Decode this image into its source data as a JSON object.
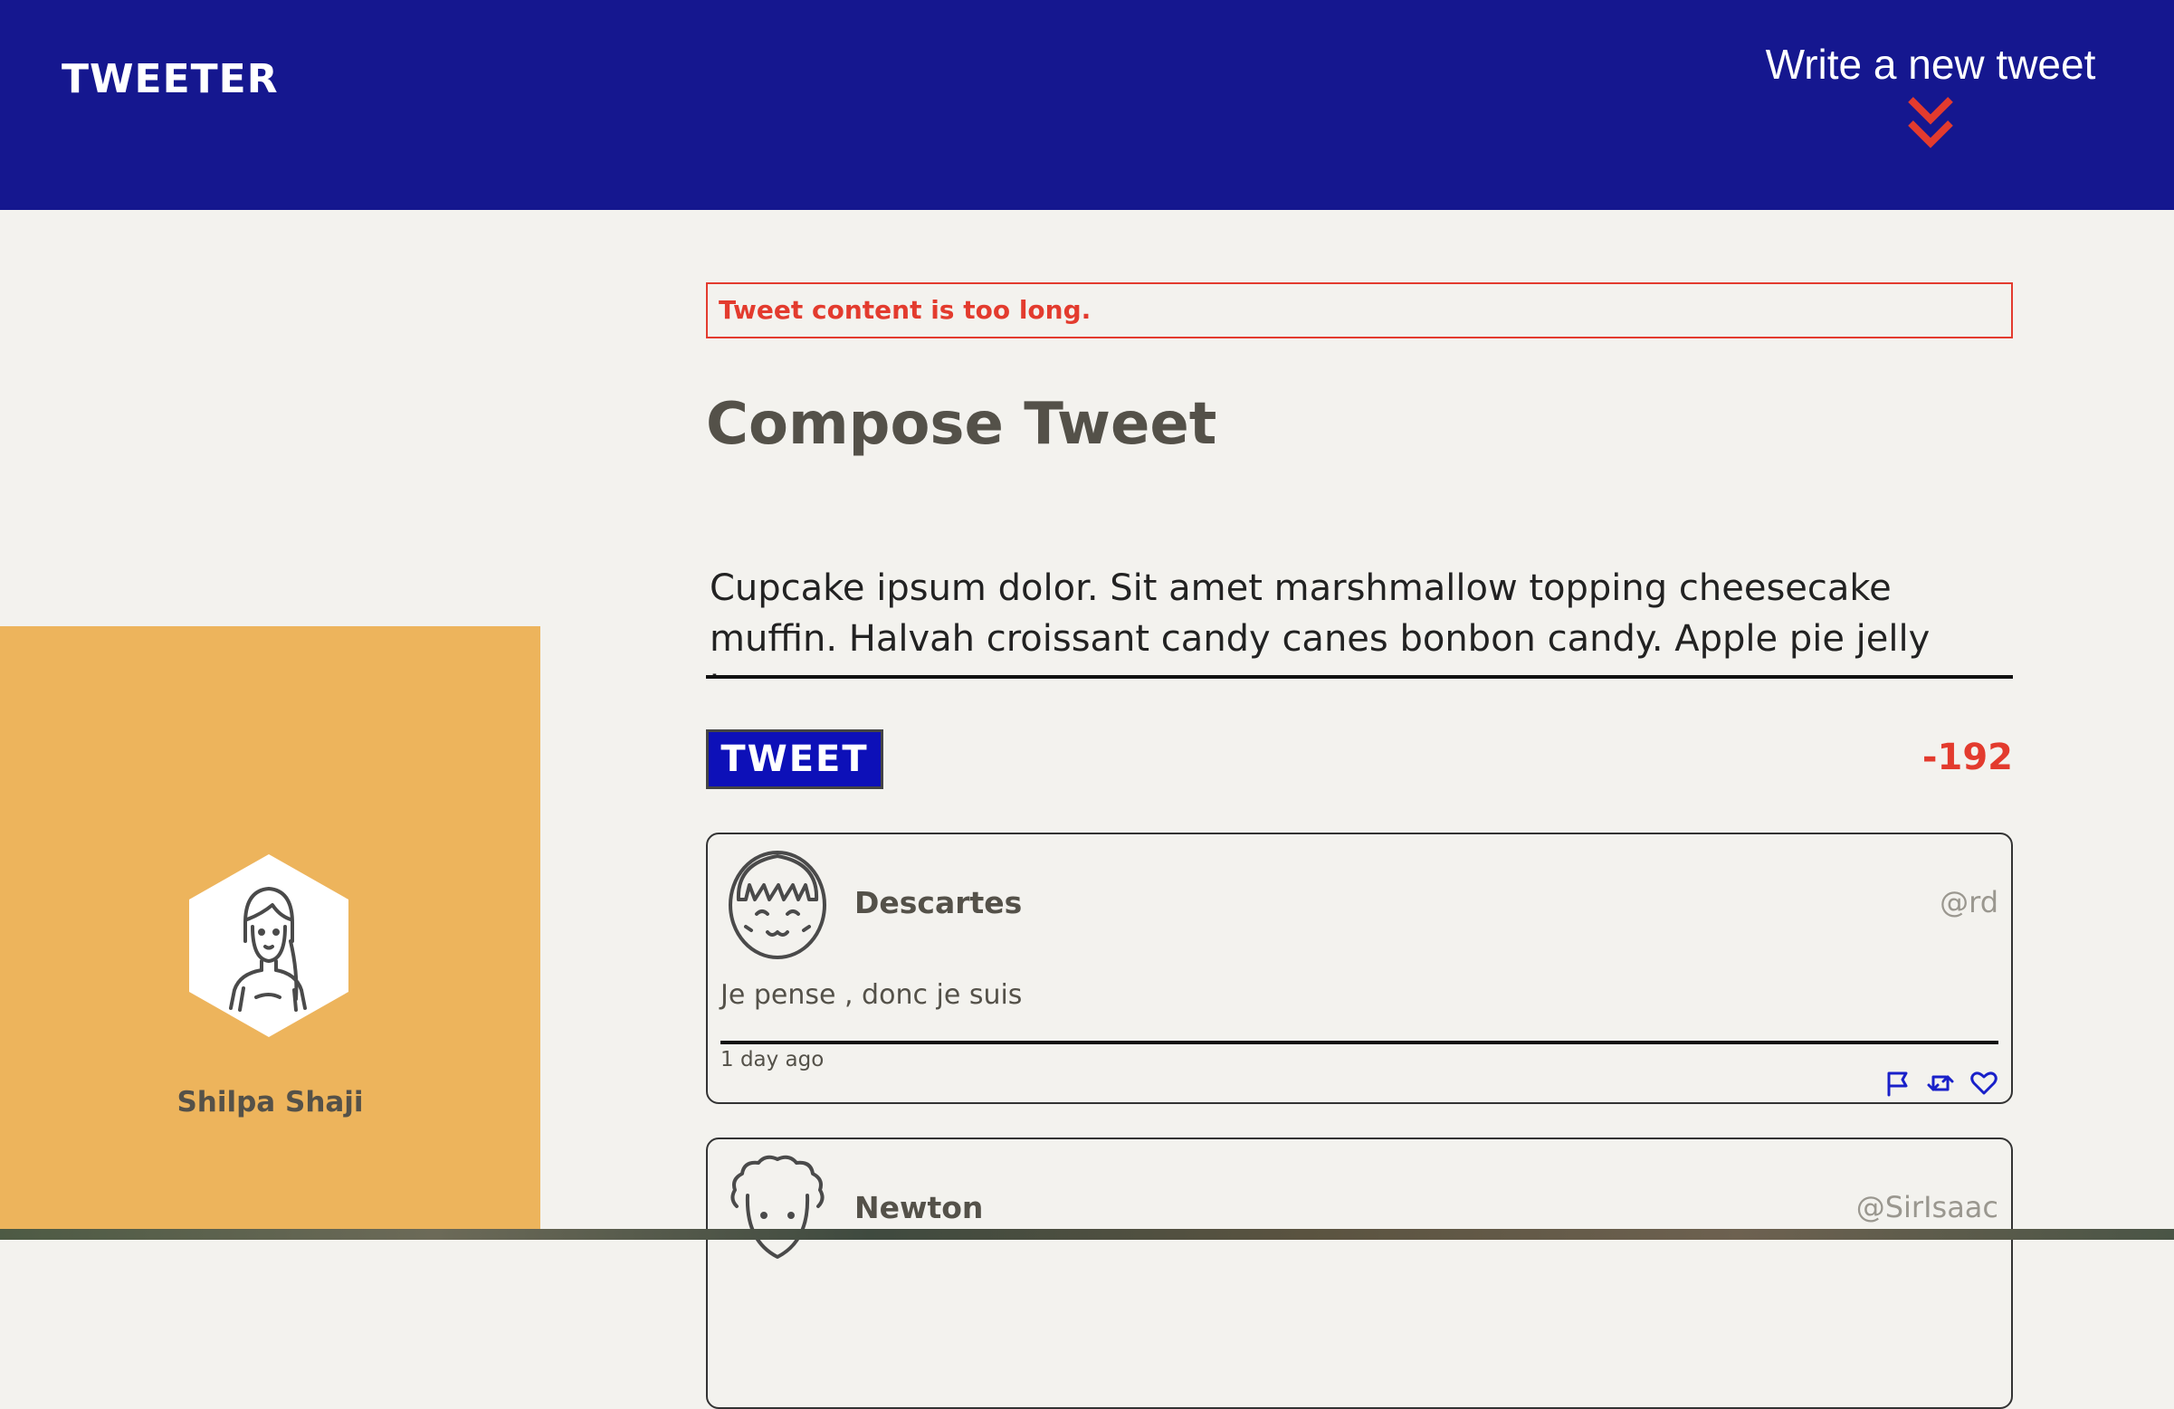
{
  "navbar": {
    "brand": "TWEETER",
    "write_new_label": "Write a new tweet",
    "chevron_icon": "double-chevron-down-icon",
    "background": "#15178f",
    "accent": "#e33b2e"
  },
  "profile": {
    "name": "Shilpa Shaji",
    "avatar_icon": "user-avatar-icon",
    "background": "#edb45c"
  },
  "compose": {
    "error_message": "Tweet content is too long.",
    "title": "Compose Tweet",
    "textarea_value": "Cupcake ipsum dolor. Sit amet marshmallow topping cheesecake muffin. Halvah croissant candy canes bonbon candy. Apple pie jelly beans",
    "submit_label": "TWEET",
    "counter": "-192"
  },
  "tweets": [
    {
      "name": "Descartes",
      "handle": "@rd",
      "content": "Je pense , donc je suis",
      "time": "1 day ago",
      "avatar_icon": "descartes-avatar-icon",
      "actions": [
        "flag-icon",
        "retweet-icon",
        "heart-icon"
      ]
    },
    {
      "name": "Newton",
      "handle": "@SirIsaac",
      "avatar_icon": "newton-avatar-icon"
    }
  ]
}
